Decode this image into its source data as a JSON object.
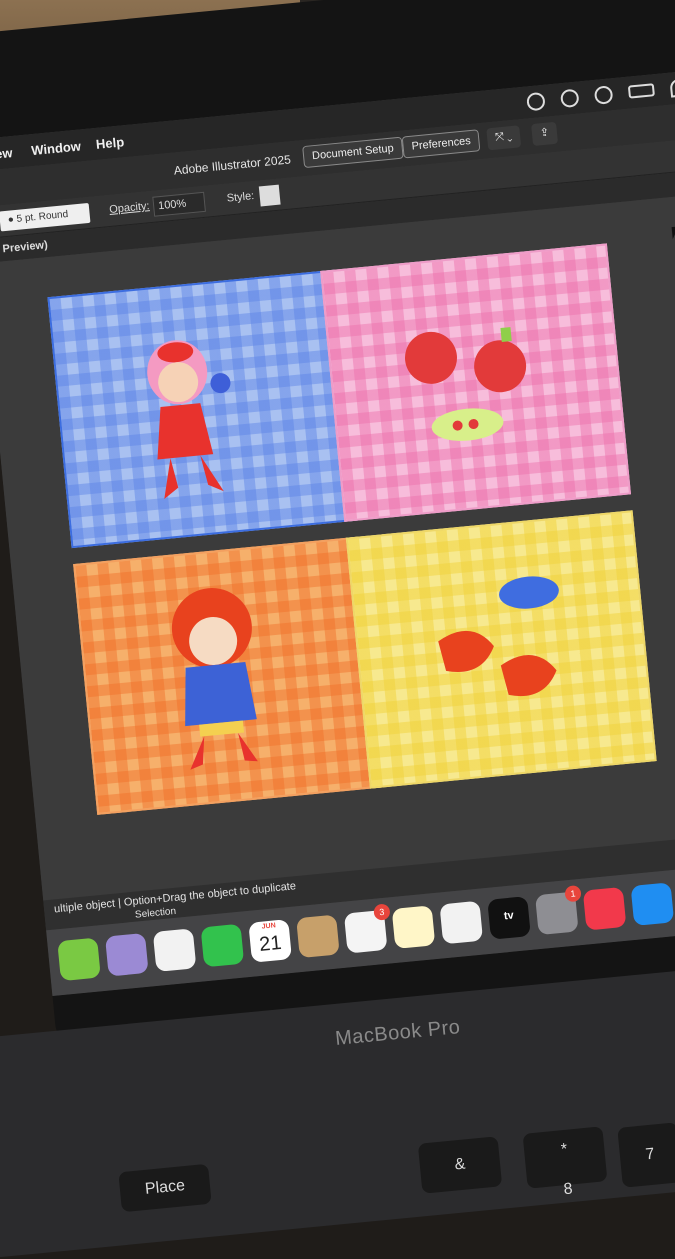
{
  "menubar": {
    "items": [
      "iew",
      "Window",
      "Help"
    ]
  },
  "titlebar": {
    "app_title": "Adobe Illustrator 2025",
    "document_setup_label": "Document Setup",
    "preferences_label": "Preferences"
  },
  "controlbar": {
    "stroke_profile": "5 pt. Round",
    "opacity_label": "Opacity:",
    "opacity_value": "100%",
    "style_label": "Style:"
  },
  "tab": {
    "label": "Preview)"
  },
  "artboards": [
    {
      "name": "blue-girl",
      "color": "#a9c1f1",
      "border": "#3c6de0"
    },
    {
      "name": "pink-apples",
      "color": "#f7bddb",
      "border": "#ee9cc8"
    },
    {
      "name": "orange-girl",
      "color": "#f6b06b",
      "border": "#f3a060"
    },
    {
      "name": "yellow-shrimp",
      "color": "#f7e98f",
      "border": "#eed767"
    }
  ],
  "statusbar": {
    "message": "ultiple object  |  Option+Drag the object to duplicate",
    "tool": "Selection"
  },
  "dock": {
    "calendar_month": "JUN",
    "calendar_day": "21",
    "reminders_badge": "3",
    "settings_badge": "1",
    "tv_label": "tv"
  },
  "laptop": {
    "model_label": "MacBook Pro"
  },
  "keyboard": {
    "place_key": "Place",
    "amp_key": "&",
    "star_key": "*",
    "seven_key": "7",
    "eight_key": "8"
  }
}
